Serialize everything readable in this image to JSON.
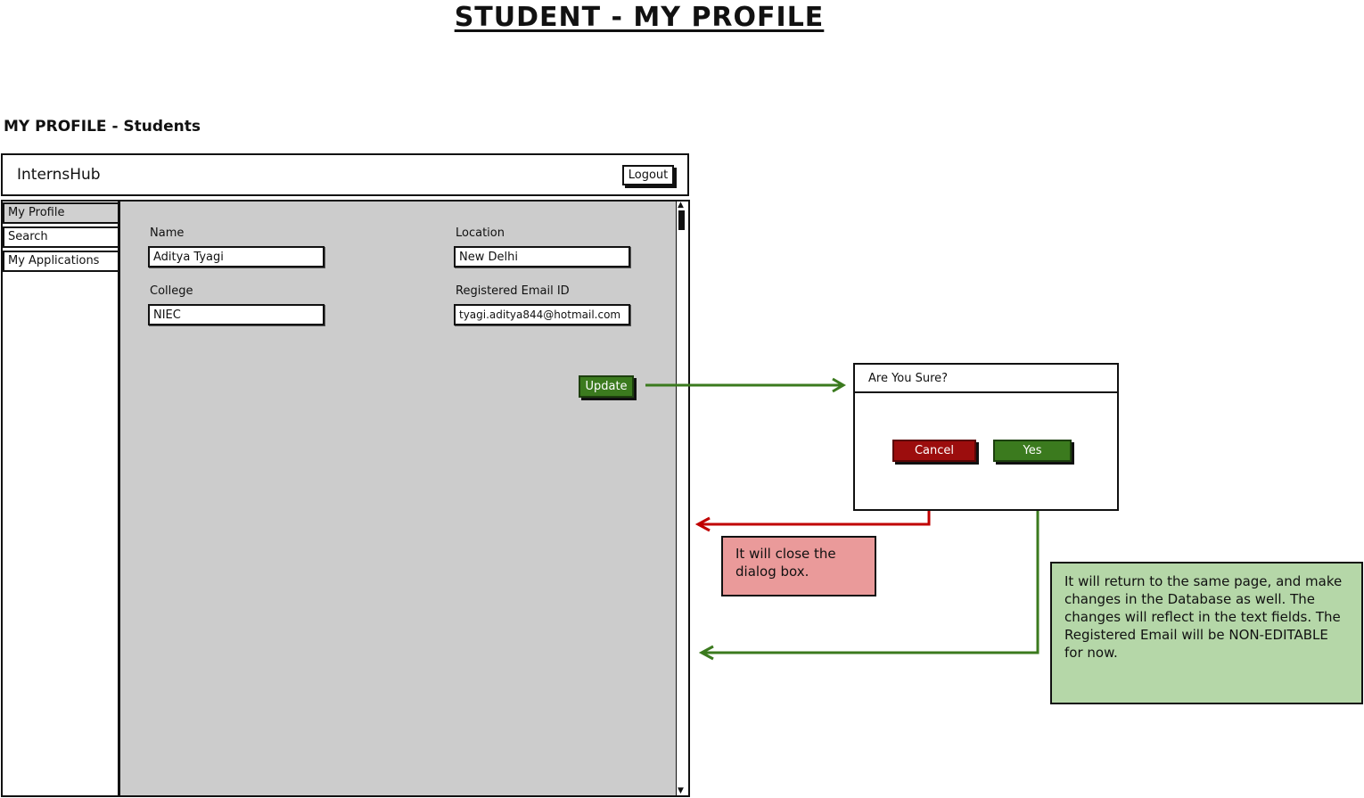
{
  "page_title": "STUDENT - MY PROFILE",
  "section_title": "MY PROFILE - Students",
  "app": {
    "brand": "InternsHub",
    "logout_label": "Logout"
  },
  "sidebar": {
    "items": [
      {
        "label": "My Profile",
        "active": true
      },
      {
        "label": "Search",
        "active": false
      },
      {
        "label": "My Applications",
        "active": false
      }
    ]
  },
  "form": {
    "name_label": "Name",
    "name_value": "Aditya Tyagi",
    "location_label": "Location",
    "location_value": "New Delhi",
    "college_label": "College",
    "college_value": "NIEC",
    "email_label": "Registered Email ID",
    "email_value": "tyagi.aditya844@hotmail.com",
    "update_label": "Update"
  },
  "dialog": {
    "title": "Are You Sure?",
    "cancel_label": "Cancel",
    "yes_label": "Yes"
  },
  "notes": {
    "cancel_note": "It will close the dialog box.",
    "yes_note": "It will return to the same page, and make changes in the Database as well. The changes will reflect in the text fields. The Registered Email will be NON-EDITABLE for now."
  },
  "colors": {
    "green": "#3b7a1e",
    "red": "#9c0d0d",
    "note_red": "#ea9a9a",
    "note_green": "#b5d7a8",
    "content_bg": "#cccccc"
  },
  "icons": {
    "scroll_up": "triangle-up-icon",
    "scroll_down": "triangle-down-icon"
  }
}
